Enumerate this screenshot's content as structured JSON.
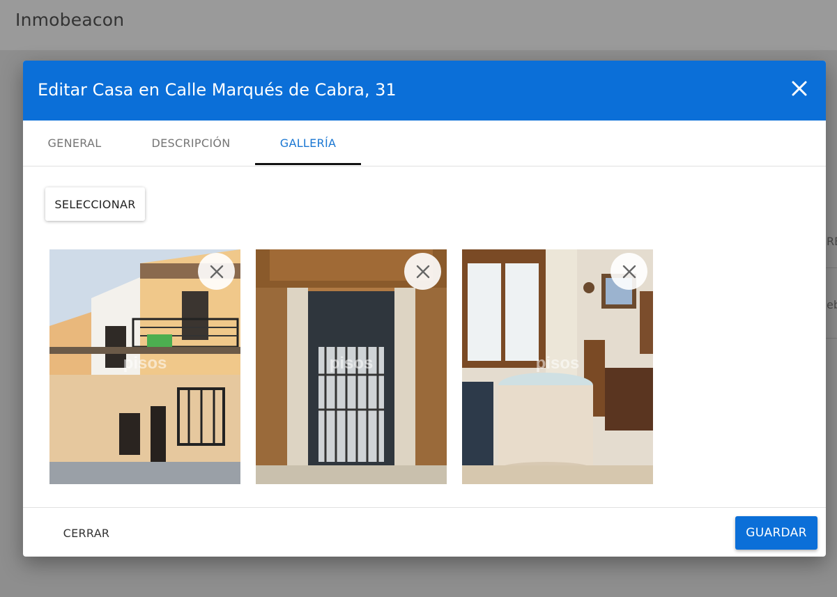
{
  "app": {
    "title": "Inmobeacon"
  },
  "background_peek": {
    "col_text": "RE",
    "row_text": "eb"
  },
  "dialog": {
    "title": "Editar Casa en Calle Marqués de Cabra, 31",
    "close_icon": "close-icon",
    "tabs": [
      {
        "label": "GENERAL",
        "active": false
      },
      {
        "label": "DESCRIPCIÓN",
        "active": false
      },
      {
        "label": "GALLERÍA",
        "active": true
      }
    ],
    "select_button": "SELECCIONAR",
    "gallery": [
      {
        "alt": "Fachada",
        "watermark": "pisos"
      },
      {
        "alt": "Puerta de entrada",
        "watermark": "pisos"
      },
      {
        "alt": "Salón con mesa camilla",
        "watermark": "pisos"
      }
    ],
    "footer": {
      "close_label": "CERRAR",
      "save_label": "GUARDAR"
    }
  },
  "colors": {
    "primary": "#0b6fd8",
    "tab_active": "#1976d2"
  }
}
